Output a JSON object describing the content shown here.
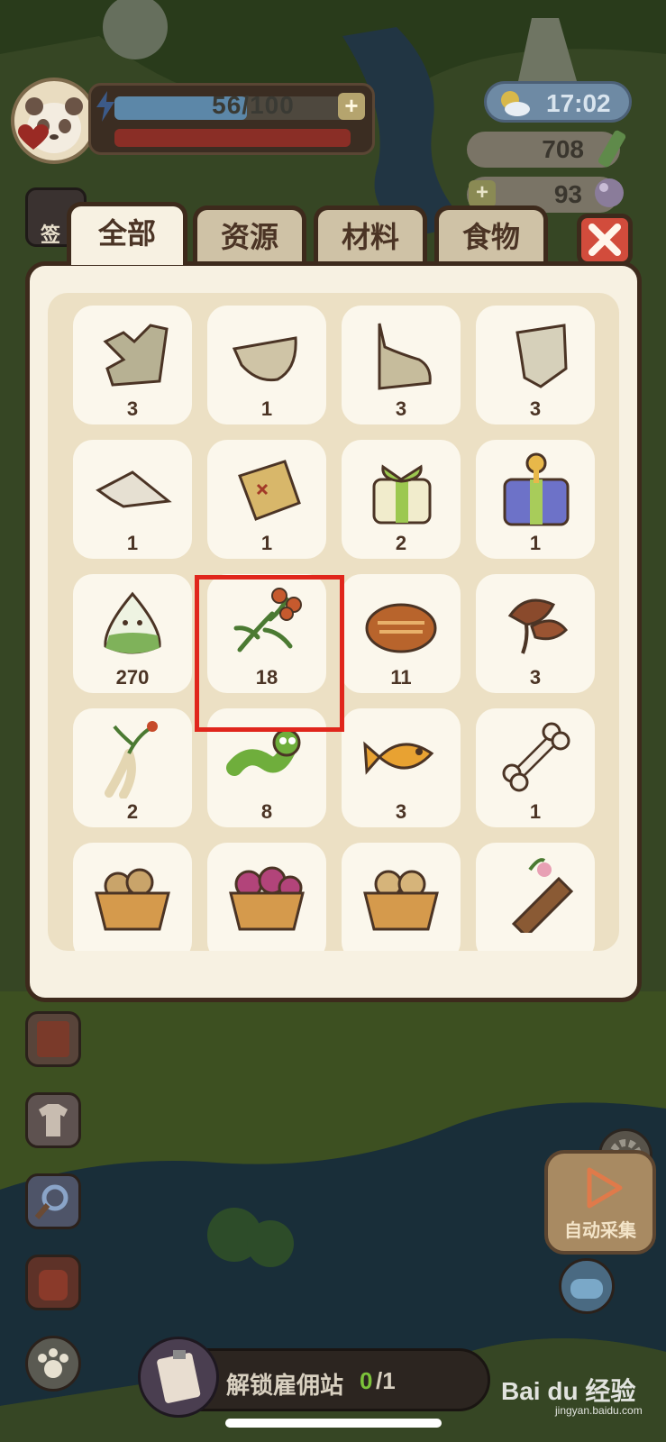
{
  "hud": {
    "energy_text": "56/100",
    "energy_fraction": 0.56,
    "energy_plus": "+",
    "time": "17:02",
    "coins": "708",
    "gems": "93",
    "gems_plus": "+",
    "sign_label": "签"
  },
  "tabs": [
    {
      "label": "全部",
      "active": true
    },
    {
      "label": "资源",
      "active": false
    },
    {
      "label": "材料",
      "active": false
    },
    {
      "label": "食物",
      "active": false
    }
  ],
  "inventory": {
    "items": [
      {
        "icon": "map-fragment-1-icon",
        "count": "3"
      },
      {
        "icon": "map-fragment-2-icon",
        "count": "1"
      },
      {
        "icon": "map-fragment-3-icon",
        "count": "3"
      },
      {
        "icon": "map-fragment-4-icon",
        "count": "3"
      },
      {
        "icon": "map-fragment-5-icon",
        "count": "1"
      },
      {
        "icon": "treasure-map-icon",
        "count": "1"
      },
      {
        "icon": "green-gift-box-icon",
        "count": "2"
      },
      {
        "icon": "blue-gift-box-icon",
        "count": "1"
      },
      {
        "icon": "rice-dumpling-icon",
        "count": "270"
      },
      {
        "icon": "berry-herb-icon",
        "count": "18"
      },
      {
        "icon": "bread-icon",
        "count": "11"
      },
      {
        "icon": "lingzhi-mushroom-icon",
        "count": "3"
      },
      {
        "icon": "ginseng-icon",
        "count": "2"
      },
      {
        "icon": "caterpillar-icon",
        "count": "8"
      },
      {
        "icon": "fish-icon",
        "count": "3"
      },
      {
        "icon": "bone-icon",
        "count": "1"
      },
      {
        "icon": "potato-basket-icon",
        "count": ""
      },
      {
        "icon": "flower-basket-icon",
        "count": ""
      },
      {
        "icon": "potato-basket-2-icon",
        "count": ""
      },
      {
        "icon": "wood-log-icon",
        "count": ""
      }
    ]
  },
  "auto_collect": {
    "label": "自动采集"
  },
  "hire": {
    "label": "解锁雇佣站",
    "current": "0",
    "total": "/1"
  },
  "watermark": {
    "brand": "Bai du 经验",
    "url": "jingyan.baidu.com"
  },
  "colors": {
    "highlight": "#e0261c",
    "panel": "#f7f1e2",
    "close": "#d24c3c"
  }
}
